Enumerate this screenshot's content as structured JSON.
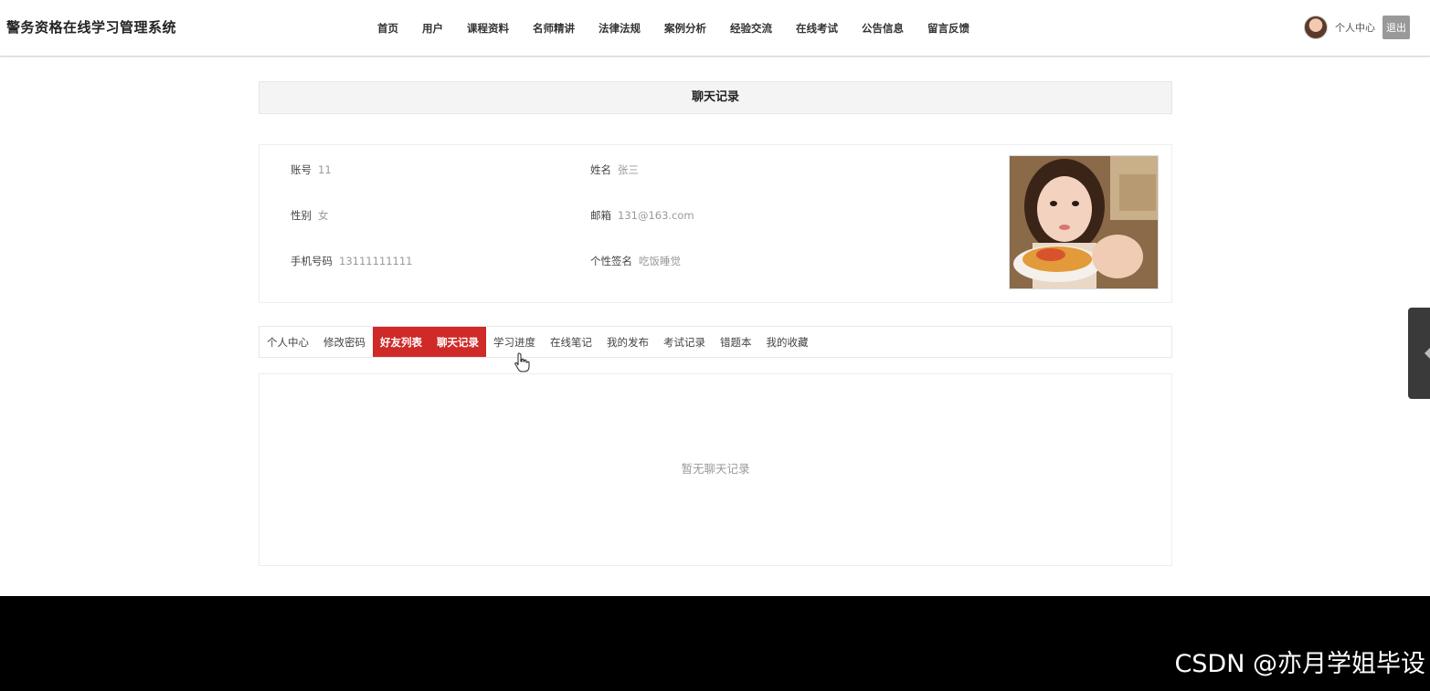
{
  "header": {
    "site_title": "警务资格在线学习管理系统",
    "nav": [
      "首页",
      "用户",
      "课程资料",
      "名师精讲",
      "法律法规",
      "案例分析",
      "经验交流",
      "在线考试",
      "公告信息",
      "留言反馈"
    ],
    "user_center": "个人中心",
    "logout": "退出"
  },
  "page_title": "聊天记录",
  "profile": {
    "account_label": "账号",
    "account": "11",
    "name_label": "姓名",
    "name": "张三",
    "gender_label": "性别",
    "gender": "女",
    "email_label": "邮箱",
    "email": "131@163.com",
    "phone_label": "手机号码",
    "phone": "13111111111",
    "signature_label": "个性签名",
    "signature": "吃饭睡觉"
  },
  "tabs": [
    {
      "label": "个人中心",
      "active": false
    },
    {
      "label": "修改密码",
      "active": false
    },
    {
      "label": "好友列表",
      "active": true
    },
    {
      "label": "聊天记录",
      "active": true
    },
    {
      "label": "学习进度",
      "active": false
    },
    {
      "label": "在线笔记",
      "active": false
    },
    {
      "label": "我的发布",
      "active": false
    },
    {
      "label": "考试记录",
      "active": false
    },
    {
      "label": "错题本",
      "active": false
    },
    {
      "label": "我的收藏",
      "active": false
    }
  ],
  "empty_message": "暂无聊天记录",
  "watermark": "CSDN @亦月学姐毕设",
  "colors": {
    "accent": "#cf2a27",
    "footer": "#000000",
    "title_bar": "#f4f4f5"
  }
}
